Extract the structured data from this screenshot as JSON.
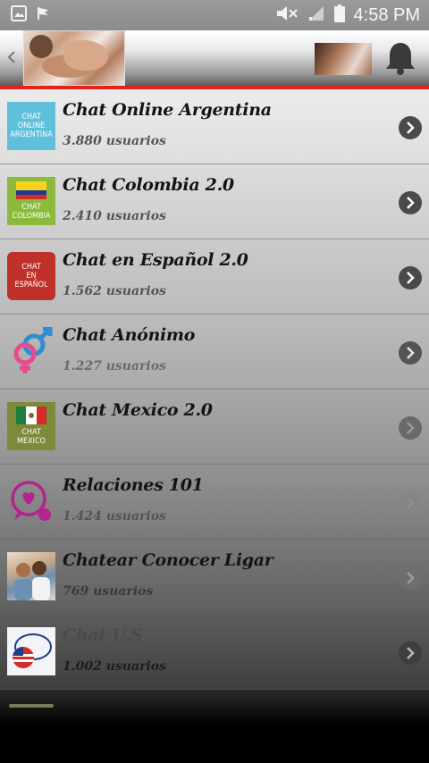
{
  "status_bar": {
    "time": "4:58 PM"
  },
  "header": {
    "back_icon": "chevron-left-icon",
    "notification_icon": "bell-icon"
  },
  "chats": [
    {
      "title": "Chat Online Argentina",
      "subtitle": "3.880 usuarios",
      "icon_text": [
        "CHAT",
        "ONLINE",
        "ARGENTINA"
      ],
      "icon_bg": "#5fc0dc",
      "icon_fg": "#ffffff"
    },
    {
      "title": "Chat Colombia 2.0",
      "subtitle": "2.410 usuarios",
      "icon_text": [
        "CHAT",
        "COLOMBIA"
      ],
      "icon_bg": "#8cba3a",
      "icon_fg": "#ffffff"
    },
    {
      "title": "Chat en Español 2.0",
      "subtitle": "1.562 usuarios",
      "icon_text": [
        "CHAT",
        "EN",
        "ESPAÑOL"
      ],
      "icon_bg": "#c0302a",
      "icon_fg": "#ffffff"
    },
    {
      "title": "Chat Anónimo",
      "subtitle": "1.227 usuarios",
      "icon_text": [],
      "icon_bg": "transparent",
      "icon_fg": "#e94b8c"
    },
    {
      "title": "Chat Mexico 2.0",
      "subtitle": "",
      "icon_text": [
        "CHAT",
        "MEXICO"
      ],
      "icon_bg": "#7c8a3a",
      "icon_fg": "#ffffff"
    },
    {
      "title": "Relaciones 101",
      "subtitle": "1.424 usuarios",
      "icon_text": [],
      "icon_bg": "transparent",
      "icon_fg": "#b5238c"
    },
    {
      "title": "Chatear Conocer Ligar",
      "subtitle": "769 usuarios",
      "icon_text": [],
      "icon_bg": "#c9b49a",
      "icon_fg": "#ffffff"
    },
    {
      "title": "Chat U.S",
      "subtitle": "1.002 usuarios",
      "icon_text": [],
      "icon_bg": "#f2f4f8",
      "icon_fg": "#1f3c88"
    }
  ]
}
